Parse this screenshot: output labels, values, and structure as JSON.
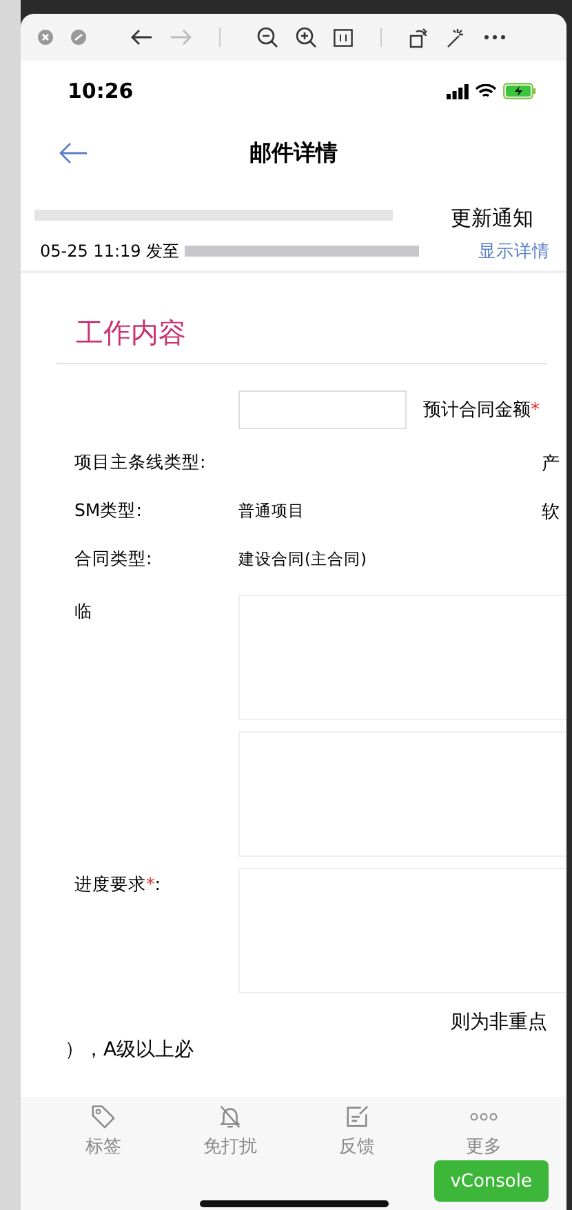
{
  "status_bar": {
    "time": "10:26"
  },
  "nav": {
    "title": "邮件详情"
  },
  "mail": {
    "subject_tail": "更新通知",
    "meta": "05-25 11:19 发至",
    "details_link": "显示详情"
  },
  "section": {
    "title": "工作内容"
  },
  "fields": [
    {
      "kind": "amount",
      "label": "预计合同金额",
      "required_mark": "*"
    },
    {
      "kind": "pair",
      "label": "项目主条线类型:",
      "side": "产"
    },
    {
      "kind": "pair",
      "label": "SM类型:",
      "value": "普通项目",
      "side": "软"
    },
    {
      "kind": "pair",
      "label": "合同类型:",
      "value": "建设合同(主合同)"
    },
    {
      "kind": "textarea",
      "label": "临"
    },
    {
      "kind": "textarea"
    },
    {
      "kind": "textarea",
      "label": "进度要求",
      "required_mark": "*",
      "label_end": ":"
    }
  ],
  "note": {
    "line_1": "则为非重点",
    "line_2": "），A级以上必"
  },
  "tabs": [
    {
      "kind": "tag",
      "label": "标签"
    },
    {
      "kind": "mute",
      "label": "免打扰"
    },
    {
      "kind": "feedback",
      "label": "反馈"
    },
    {
      "kind": "more",
      "label": "更多"
    }
  ],
  "console_button": "vConsole"
}
